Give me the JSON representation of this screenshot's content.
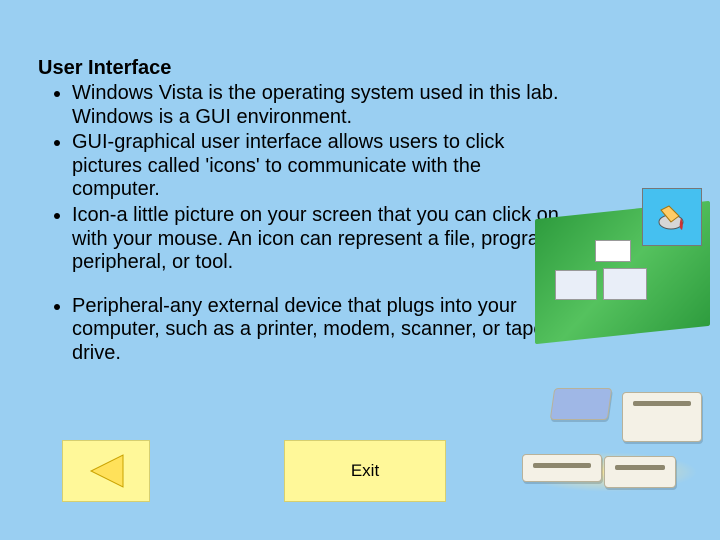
{
  "title": "User Interface",
  "bullets": [
    "Windows Vista is the operating system used in this lab.  Windows is a GUI environment.",
    "GUI-graphical user interface allows users to click pictures called 'icons'  to communicate with the computer.",
    "Icon-a little picture on your screen that you can click on with your mouse. An icon can represent a file, program, peripheral, or tool.",
    "Peripheral-any external device that plugs into your computer, such as a printer, modem, scanner, or tape drive."
  ],
  "buttons": {
    "exit_label": "Exit"
  }
}
